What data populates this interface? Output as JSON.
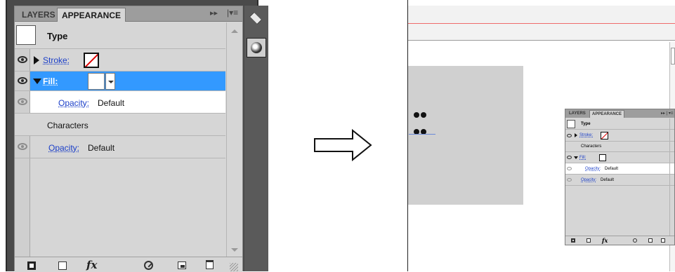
{
  "panel": {
    "tabs": [
      "LAYERS",
      "APPEARANCE"
    ],
    "menu_icons": [
      "▸▸",
      "|▾≡"
    ],
    "type_label": "Type",
    "stroke_label": "Stroke:",
    "fill_label": "Fill:",
    "opacity_label": "Opacity:",
    "opacity_value": "Default",
    "characters_label": "Characters",
    "opacity2_label": "Opacity:",
    "opacity2_value": "Default",
    "fx_label": "fx"
  },
  "mini_panel": {
    "tabs": [
      "LAYERS",
      "APPEARANCE"
    ],
    "menu_icon": "▸▸ | ▾≡",
    "type_label": "Type",
    "stroke_label": "Stroke:",
    "characters_label": "Characters",
    "fill_label": "Fill:",
    "opacity_label": "Opacity:",
    "opacity_value": "Default",
    "opacity2_label": "Opacity:",
    "opacity2_value": "Default",
    "fx_label": "fx"
  },
  "colors": {
    "selected_row": "#3399ff",
    "link_blue": "#1a3ec8",
    "guide_red": "#ef6b6b",
    "panel_gray": "#d6d6d6"
  },
  "icons": [
    "eye-icon",
    "disclosure-triangle-icon",
    "none-swatch-icon",
    "layers-icon",
    "appearance-icon",
    "add-stroke-icon",
    "add-fill-icon",
    "fx-icon",
    "clear-icon",
    "duplicate-icon",
    "delete-icon",
    "right-arrow-icon"
  ]
}
